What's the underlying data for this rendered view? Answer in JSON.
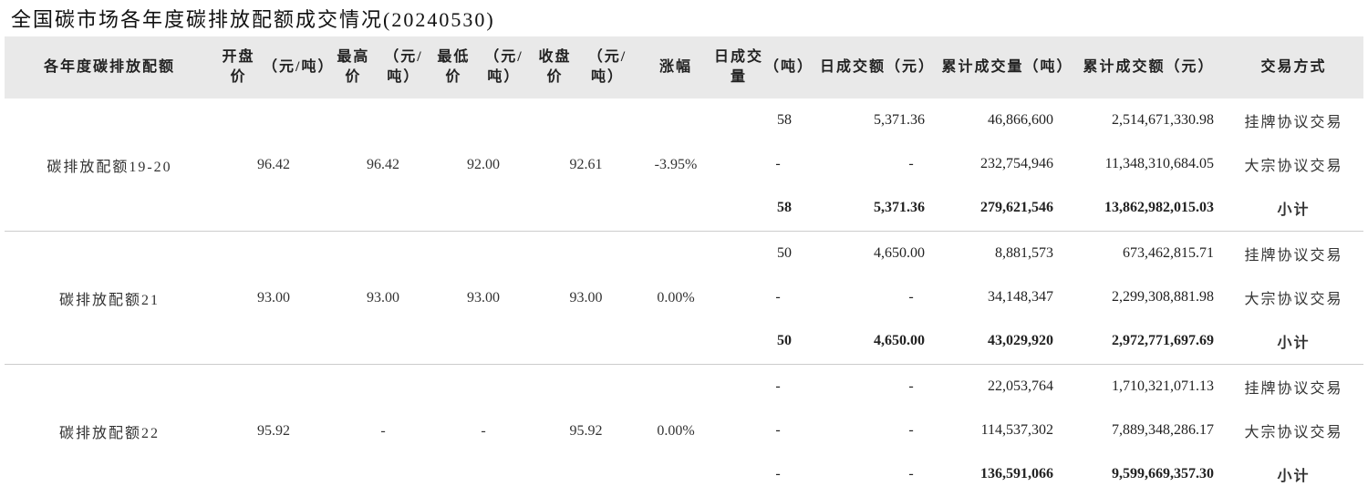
{
  "title": "全国碳市场各年度碳排放配额成交情况(20240530)",
  "headers": [
    "各年度\n碳排放配额",
    "开盘价\n（元/吨）",
    "最高价\n（元/吨）",
    "最低价\n（元/吨）",
    "收盘价\n（元/吨）",
    "涨幅",
    "日成交量\n（吨）",
    "日成交额\n（元）",
    "累计成交量\n（吨）",
    "累计成交额\n（元）",
    "交易方式"
  ],
  "groups": [
    {
      "name": "碳排放配额19-20",
      "open": "96.42",
      "high": "96.42",
      "low": "92.00",
      "close": "92.61",
      "change": "-3.95%",
      "rows": [
        {
          "vol": "58",
          "amt": "5,371.36",
          "cum_vol": "46,866,600",
          "cum_amt": "2,514,671,330.98",
          "method": "挂牌协议交易"
        },
        {
          "vol": "-",
          "amt": "-",
          "cum_vol": "232,754,946",
          "cum_amt": "11,348,310,684.05",
          "method": "大宗协议交易"
        },
        {
          "vol": "58",
          "amt": "5,371.36",
          "cum_vol": "279,621,546",
          "cum_amt": "13,862,982,015.03",
          "method": "小计"
        }
      ]
    },
    {
      "name": "碳排放配额21",
      "open": "93.00",
      "high": "93.00",
      "low": "93.00",
      "close": "93.00",
      "change": "0.00%",
      "rows": [
        {
          "vol": "50",
          "amt": "4,650.00",
          "cum_vol": "8,881,573",
          "cum_amt": "673,462,815.71",
          "method": "挂牌协议交易"
        },
        {
          "vol": "-",
          "amt": "-",
          "cum_vol": "34,148,347",
          "cum_amt": "2,299,308,881.98",
          "method": "大宗协议交易"
        },
        {
          "vol": "50",
          "amt": "4,650.00",
          "cum_vol": "43,029,920",
          "cum_amt": "2,972,771,697.69",
          "method": "小计"
        }
      ]
    },
    {
      "name": "碳排放配额22",
      "open": "95.92",
      "high": "-",
      "low": "-",
      "close": "95.92",
      "change": "0.00%",
      "rows": [
        {
          "vol": "-",
          "amt": "-",
          "cum_vol": "22,053,764",
          "cum_amt": "1,710,321,071.13",
          "method": "挂牌协议交易"
        },
        {
          "vol": "-",
          "amt": "-",
          "cum_vol": "114,537,302",
          "cum_amt": "7,889,348,286.17",
          "method": "大宗协议交易"
        },
        {
          "vol": "-",
          "amt": "-",
          "cum_vol": "136,591,066",
          "cum_amt": "9,599,669,357.30",
          "method": "小计"
        }
      ]
    }
  ]
}
